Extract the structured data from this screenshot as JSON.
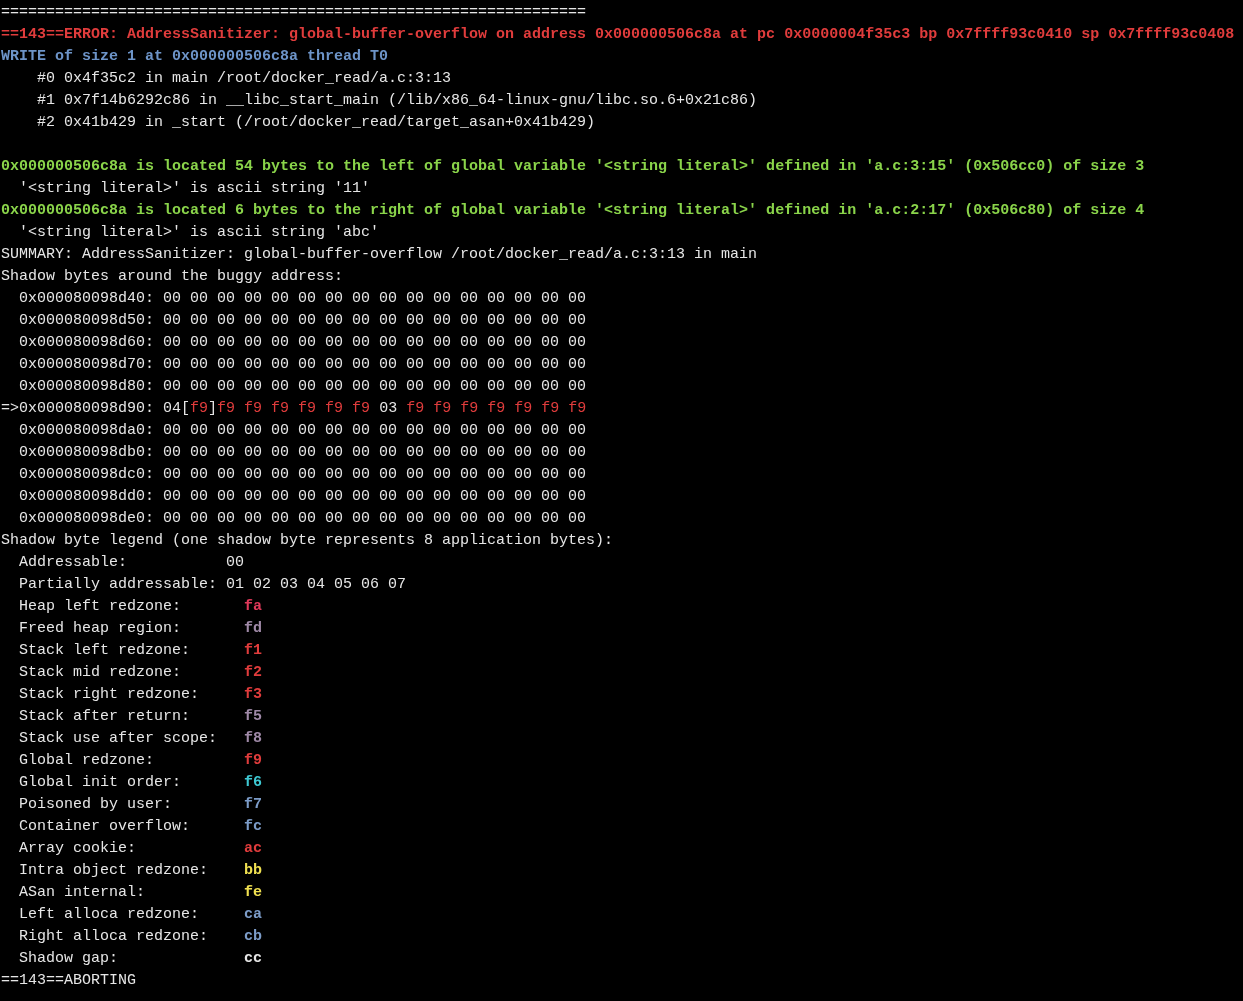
{
  "terminal": {
    "lines": [
      {
        "kind": "rule",
        "text": "================================================================="
      },
      {
        "kind": "error",
        "text": "==143==ERROR: AddressSanitizer: global-buffer-overflow on address 0x000000506c8a at pc 0x0000004f35c3 bp 0x7ffff93c0410 sp 0x7ffff93c0408"
      },
      {
        "kind": "access",
        "text": "WRITE of size 1 at 0x000000506c8a thread T0"
      },
      {
        "kind": "frame",
        "text": "#0 0x4f35c2 in main /root/docker_read/a.c:3:13"
      },
      {
        "kind": "frame",
        "text": "#1 0x7f14b6292c86 in __libc_start_main (/lib/x86_64-linux-gnu/libc.so.6+0x21c86)"
      },
      {
        "kind": "frame",
        "text": "#2 0x41b429 in _start (/root/docker_read/target_asan+0x41b429)"
      },
      {
        "kind": "blank"
      },
      {
        "kind": "location",
        "text": "0x000000506c8a is located 54 bytes to the left of global variable '<string literal>' defined in 'a.c:3:15' (0x506cc0) of size 3"
      },
      {
        "kind": "detail",
        "text": "'<string literal>' is ascii string '11'"
      },
      {
        "kind": "location",
        "text": "0x000000506c8a is located 6 bytes to the right of global variable '<string literal>' defined in 'a.c:2:17' (0x506c80) of size 4"
      },
      {
        "kind": "detail",
        "text": "'<string literal>' is ascii string 'abc'"
      },
      {
        "kind": "plain",
        "text": "SUMMARY: AddressSanitizer: global-buffer-overflow /root/docker_read/a.c:3:13 in main"
      },
      {
        "kind": "plain",
        "text": "Shadow bytes around the buggy address:"
      }
    ],
    "shadow_rows": [
      {
        "kind": "row",
        "address": "0x000080098d40:",
        "bytes": "00 00 00 00 00 00 00 00 00 00 00 00 00 00 00 00"
      },
      {
        "kind": "row",
        "address": "0x000080098d50:",
        "bytes": "00 00 00 00 00 00 00 00 00 00 00 00 00 00 00 00"
      },
      {
        "kind": "row",
        "address": "0x000080098d60:",
        "bytes": "00 00 00 00 00 00 00 00 00 00 00 00 00 00 00 00"
      },
      {
        "kind": "row",
        "address": "0x000080098d70:",
        "bytes": "00 00 00 00 00 00 00 00 00 00 00 00 00 00 00 00"
      },
      {
        "kind": "row",
        "address": "0x000080098d80:",
        "bytes": "00 00 00 00 00 00 00 00 00 00 00 00 00 00 00 00"
      },
      {
        "kind": "buggy",
        "address": "=>0x000080098d90:",
        "segments": [
          {
            "text": "04",
            "color": "#e6e6e6"
          },
          {
            "text": "[",
            "color": "#e6e6e6"
          },
          {
            "text": "f9",
            "color": "#e03c3c"
          },
          {
            "text": "]",
            "color": "#e6e6e6"
          },
          {
            "text": "f9 f9 f9 f9 f9 f9",
            "color": "#e03c3c"
          },
          {
            "text": "03",
            "color": "#e6e6e6"
          },
          {
            "text": "f9 f9 f9 f9 f9 f9 f9",
            "color": "#e03c3c"
          }
        ]
      },
      {
        "kind": "row",
        "address": "0x000080098da0:",
        "bytes": "00 00 00 00 00 00 00 00 00 00 00 00 00 00 00 00"
      },
      {
        "kind": "row",
        "address": "0x000080098db0:",
        "bytes": "00 00 00 00 00 00 00 00 00 00 00 00 00 00 00 00"
      },
      {
        "kind": "row",
        "address": "0x000080098dc0:",
        "bytes": "00 00 00 00 00 00 00 00 00 00 00 00 00 00 00 00"
      },
      {
        "kind": "row",
        "address": "0x000080098dd0:",
        "bytes": "00 00 00 00 00 00 00 00 00 00 00 00 00 00 00 00"
      },
      {
        "kind": "row",
        "address": "0x000080098de0:",
        "bytes": "00 00 00 00 00 00 00 00 00 00 00 00 00 00 00 00"
      }
    ],
    "legend_title": "Shadow byte legend (one shadow byte represents 8 application bytes):",
    "legend": [
      {
        "kind": "addressable",
        "label": "Addressable:",
        "code": "00"
      },
      {
        "kind": "addressable",
        "label": "Partially addressable:",
        "code": "01 02 03 04 05 06 07"
      },
      {
        "kind": "redzone",
        "label": "Heap left redzone:",
        "code": "fa",
        "color": "#e0395a"
      },
      {
        "kind": "redzone",
        "label": "Freed heap region:",
        "code": "fd",
        "color": "#a08aa8"
      },
      {
        "kind": "redzone",
        "label": "Stack left redzone:",
        "code": "f1",
        "color": "#e03c3c"
      },
      {
        "kind": "redzone",
        "label": "Stack mid redzone:",
        "code": "f2",
        "color": "#e03c3c"
      },
      {
        "kind": "redzone",
        "label": "Stack right redzone:",
        "code": "f3",
        "color": "#e03c3c"
      },
      {
        "kind": "redzone",
        "label": "Stack after return:",
        "code": "f5",
        "color": "#a08aa8"
      },
      {
        "kind": "redzone",
        "label": "Stack use after scope:",
        "code": "f8",
        "color": "#a08aa8"
      },
      {
        "kind": "redzone",
        "label": "Global redzone:",
        "code": "f9",
        "color": "#e03c3c"
      },
      {
        "kind": "redzone",
        "label": "Global init order:",
        "code": "f6",
        "color": "#3ec8d2"
      },
      {
        "kind": "redzone",
        "label": "Poisoned by user:",
        "code": "f7",
        "color": "#7c9cc8"
      },
      {
        "kind": "redzone",
        "label": "Container overflow:",
        "code": "fc",
        "color": "#7c9cc8"
      },
      {
        "kind": "redzone",
        "label": "Array cookie:",
        "code": "ac",
        "color": "#e03c3c"
      },
      {
        "kind": "redzone",
        "label": "Intra object redzone:",
        "code": "bb",
        "color": "#f0e050"
      },
      {
        "kind": "redzone",
        "label": "ASan internal:",
        "code": "fe",
        "color": "#f0e050"
      },
      {
        "kind": "redzone",
        "label": "Left alloca redzone:",
        "code": "ca",
        "color": "#7c9cc8"
      },
      {
        "kind": "redzone",
        "label": "Right alloca redzone:",
        "code": "cb",
        "color": "#7c9cc8"
      },
      {
        "kind": "redzone",
        "label": "Shadow gap:",
        "code": "cc",
        "color": "#e6e6e6"
      }
    ],
    "footer": "==143==ABORTING"
  }
}
